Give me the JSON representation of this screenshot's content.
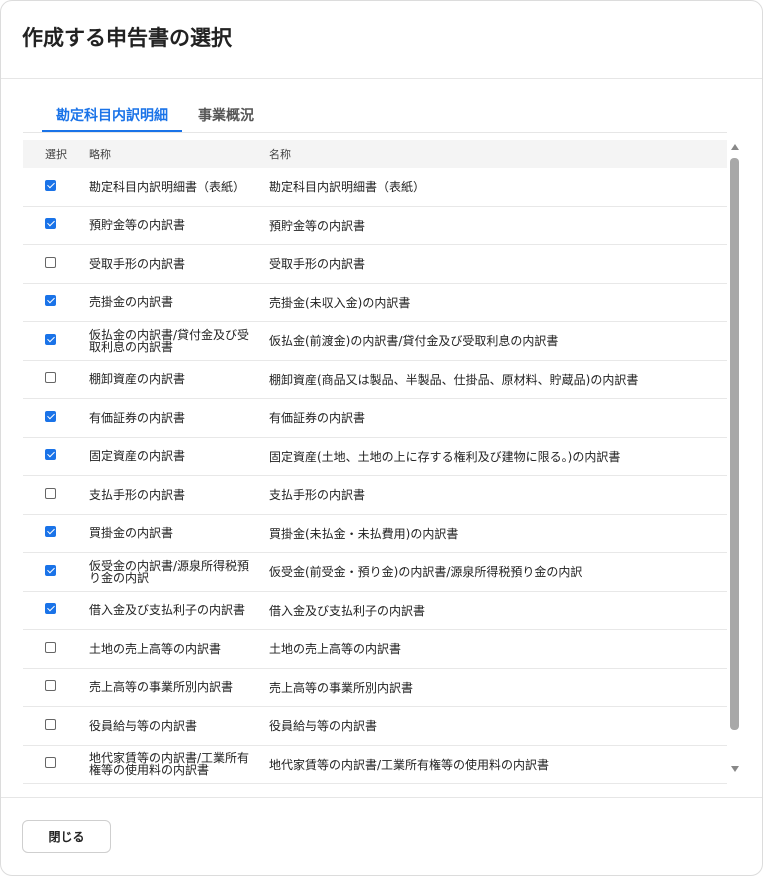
{
  "dialog": {
    "title": "作成する申告書の選択",
    "close_label": "閉じる"
  },
  "tabs": [
    {
      "label": "勘定科目内訳明細",
      "active": true
    },
    {
      "label": "事業概況",
      "active": false
    }
  ],
  "table": {
    "headers": {
      "select": "選択",
      "abbr": "略称",
      "name": "名称"
    },
    "rows": [
      {
        "checked": true,
        "abbr": "勘定科目内訳明細書（表紙）",
        "name": "勘定科目内訳明細書（表紙）"
      },
      {
        "checked": true,
        "abbr": "預貯金等の内訳書",
        "name": "預貯金等の内訳書"
      },
      {
        "checked": false,
        "abbr": "受取手形の内訳書",
        "name": "受取手形の内訳書"
      },
      {
        "checked": true,
        "abbr": "売掛金の内訳書",
        "name": "売掛金(未収入金)の内訳書"
      },
      {
        "checked": true,
        "abbr": "仮払金の内訳書/貸付金及び受取利息の内訳書",
        "name": "仮払金(前渡金)の内訳書/貸付金及び受取利息の内訳書"
      },
      {
        "checked": false,
        "abbr": "棚卸資産の内訳書",
        "name": "棚卸資産(商品又は製品、半製品、仕掛品、原材料、貯蔵品)の内訳書"
      },
      {
        "checked": true,
        "abbr": "有価証券の内訳書",
        "name": "有価証券の内訳書"
      },
      {
        "checked": true,
        "abbr": "固定資産の内訳書",
        "name": "固定資産(土地、土地の上に存する権利及び建物に限る。)の内訳書"
      },
      {
        "checked": false,
        "abbr": "支払手形の内訳書",
        "name": "支払手形の内訳書"
      },
      {
        "checked": true,
        "abbr": "買掛金の内訳書",
        "name": "買掛金(未払金・未払費用)の内訳書"
      },
      {
        "checked": true,
        "abbr": "仮受金の内訳書/源泉所得税預り金の内訳",
        "name": "仮受金(前受金・預り金)の内訳書/源泉所得税預り金の内訳"
      },
      {
        "checked": true,
        "abbr": "借入金及び支払利子の内訳書",
        "name": "借入金及び支払利子の内訳書"
      },
      {
        "checked": false,
        "abbr": "土地の売上高等の内訳書",
        "name": "土地の売上高等の内訳書"
      },
      {
        "checked": false,
        "abbr": "売上高等の事業所別内訳書",
        "name": "売上高等の事業所別内訳書"
      },
      {
        "checked": false,
        "abbr": "役員給与等の内訳書",
        "name": "役員給与等の内訳書"
      },
      {
        "checked": false,
        "abbr": "地代家賃等の内訳書/工業所有権等の使用料の内訳書",
        "name": "地代家賃等の内訳書/工業所有権等の使用料の内訳書"
      }
    ]
  }
}
